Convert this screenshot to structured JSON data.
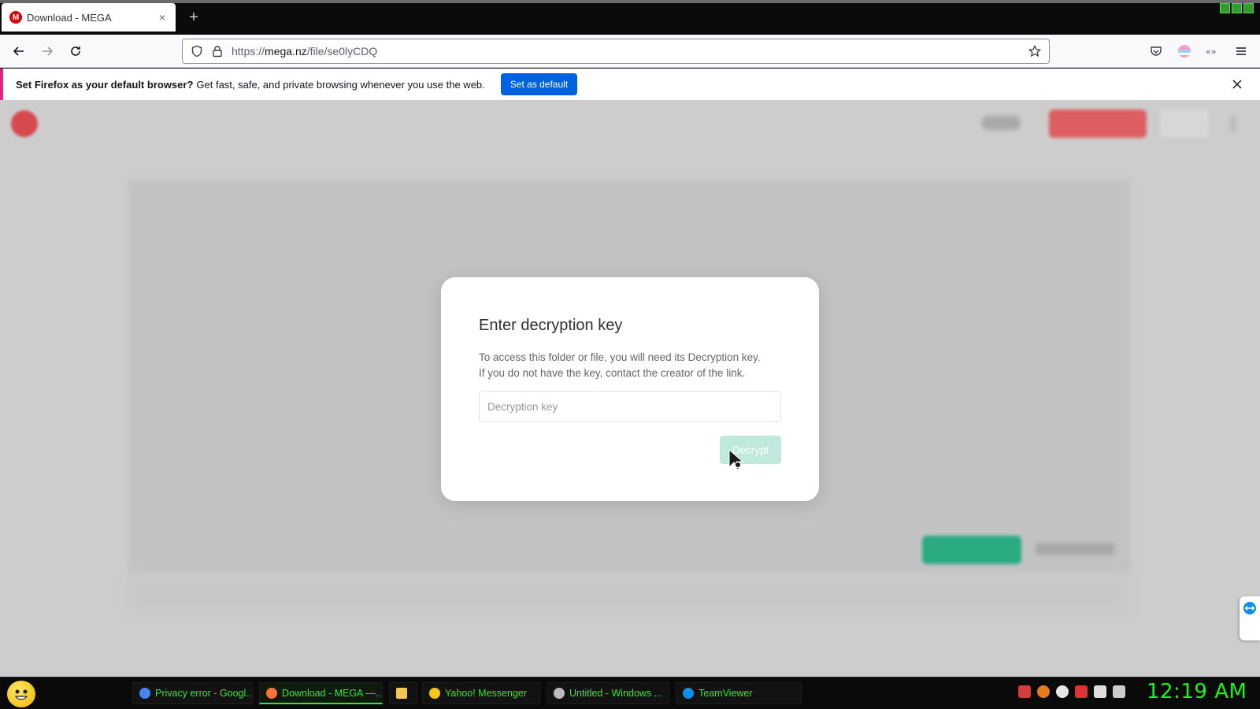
{
  "browser": {
    "tab": {
      "favicon_letter": "M",
      "title": "Download - MEGA",
      "close": "×"
    },
    "new_tab": "+",
    "url": {
      "scheme": "https://",
      "domain": "mega.nz",
      "path": "/file/se0lyCDQ"
    }
  },
  "notification": {
    "bold": "Set Firefox as your default browser?",
    "text": "Get fast, safe, and private browsing whenever you use the web.",
    "button": "Set as default"
  },
  "dialog": {
    "title": "Enter decryption key",
    "line1": "To access this folder or file, you will need its Decryption key.",
    "line2": "If you do not have the key, contact the creator of the link.",
    "input_placeholder": "Decryption key",
    "input_value": "",
    "button": "Decrypt"
  },
  "taskbar": {
    "tasks": [
      {
        "label": "Privacy error - Googl...",
        "icon": "chrome-icon",
        "color": "#4285f4"
      },
      {
        "label": "Download - MEGA —...",
        "icon": "firefox-icon",
        "color": "#ff7139"
      },
      {
        "label": "",
        "icon": "folder-icon",
        "color": "#f2c94c"
      },
      {
        "label": "Yahoo! Messenger",
        "icon": "yahoo-messenger-icon",
        "color": "#f5c518"
      },
      {
        "label": "Untitled - Windows ...",
        "icon": "windows-movie-maker-icon",
        "color": "#bbbbbb"
      },
      {
        "label": "TeamViewer",
        "icon": "teamviewer-icon",
        "color": "#0e8ee9"
      }
    ],
    "clock": "12:19 AM"
  },
  "colors": {
    "accent_blue": "#0061e0",
    "mega_red": "#d90007",
    "decrypt_disabled": "#bfe9dd",
    "taskbar_green": "#2fe82f"
  }
}
